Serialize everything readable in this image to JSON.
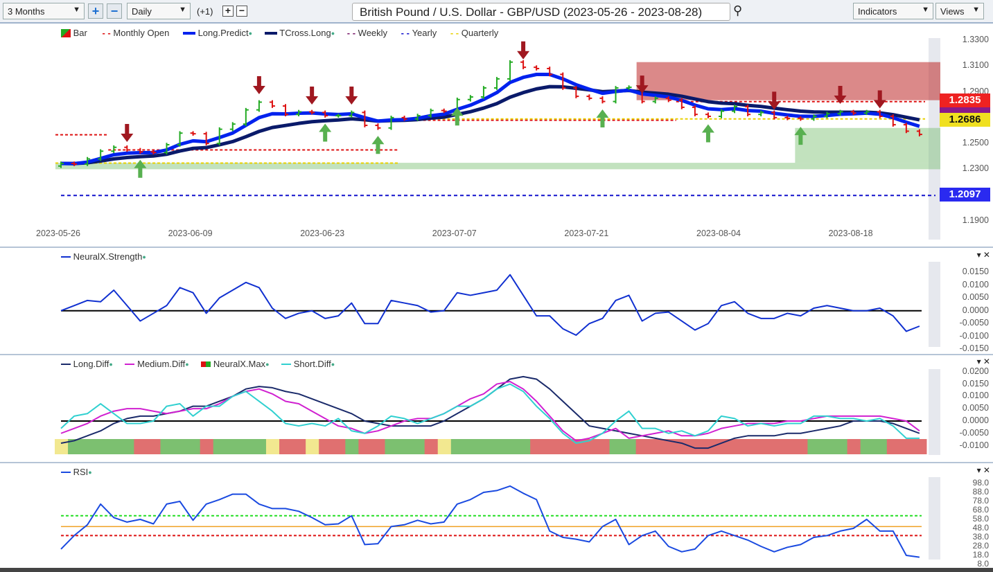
{
  "toolbar": {
    "range": "3 Months",
    "interval": "Daily",
    "offset": "(+1)",
    "title": "British Pound / U.S. Dollar - GBP/USD (2023-05-26 - 2023-08-28)",
    "indicators": "Indicators",
    "views": "Views"
  },
  "colors": {
    "bull": "#22aa22",
    "bear": "#dd1111",
    "long_predict": "#0022ee",
    "tcross": "#0a1a6a",
    "monthly": "#dd1111",
    "weekly": "#7a1a6a",
    "yearly": "#1010cc",
    "quarterly": "#e8d000",
    "strength": "#1030d0",
    "long_diff": "#1a2a6a",
    "medium_diff": "#d020d0",
    "short_diff": "#30d0d0",
    "rsi": "#1a4ae0"
  },
  "price_panel": {
    "legend": [
      "Bar",
      "Monthly Open",
      "Long.Predict",
      "TCross.Long",
      "Weekly",
      "Yearly",
      "Quarterly"
    ],
    "y_ticks": [
      "1.3300",
      "1.3100",
      "1.2900",
      "1.2500",
      "1.2300",
      "1.1900"
    ],
    "x_ticks": [
      "2023-05-26",
      "2023-06-09",
      "2023-06-23",
      "2023-07-07",
      "2023-07-21",
      "2023-08-04",
      "2023-08-18"
    ],
    "price_labels": [
      {
        "value": "1.2835",
        "color": "#ee2222"
      },
      {
        "value": "1.2686",
        "color": "#f0e020"
      },
      {
        "value": "1.2097",
        "color": "#2a2af0"
      }
    ]
  },
  "chart_data": [
    {
      "type": "candlestick",
      "ylim": [
        1.19,
        1.33
      ],
      "dates_start": "2023-05-26",
      "dates_end": "2023-08-25",
      "close": [
        1.2345,
        1.234,
        1.238,
        1.244,
        1.247,
        1.245,
        1.2435,
        1.243,
        1.249,
        1.258,
        1.2575,
        1.25,
        1.261,
        1.265,
        1.276,
        1.282,
        1.279,
        1.2725,
        1.2745,
        1.274,
        1.2715,
        1.2715,
        1.274,
        1.264,
        1.262,
        1.27,
        1.269,
        1.2715,
        1.2755,
        1.275,
        1.284,
        1.286,
        1.293,
        1.3,
        1.313,
        1.309,
        1.308,
        1.3035,
        1.293,
        1.2865,
        1.285,
        1.2825,
        1.293,
        1.2935,
        1.2825,
        1.285,
        1.2835,
        1.278,
        1.2725,
        1.271,
        1.275,
        1.2785,
        1.2725,
        1.274,
        1.27,
        1.2695,
        1.269,
        1.271,
        1.273,
        1.2745,
        1.2735,
        1.2745,
        1.271,
        1.2645,
        1.2595,
        1.257
      ],
      "sell_signals": [
        "2023-06-02",
        "2023-06-16",
        "2023-06-22",
        "2023-06-27",
        "2023-07-14",
        "2023-07-27",
        "2023-08-10",
        "2023-08-17",
        "2023-08-22"
      ],
      "buy_signals": [
        "2023-06-05",
        "2023-06-23",
        "2023-06-29",
        "2023-07-07",
        "2023-07-24",
        "2023-08-03",
        "2023-08-14"
      ],
      "monthly_open": [
        {
          "from": "2023-05-26",
          "value": 1.2567
        },
        {
          "from": "2023-06-01",
          "value": 1.245
        },
        {
          "from": "2023-07-03",
          "value": 1.268
        },
        {
          "from": "2023-08-01",
          "value": 1.2824
        }
      ],
      "quarterly": [
        {
          "from": "2023-05-26",
          "value": 1.2348
        },
        {
          "from": "2023-07-03",
          "value": 1.269
        }
      ],
      "yearly": 1.2097,
      "zones": [
        {
          "type": "resistance",
          "low": 1.2835,
          "high": 1.313,
          "from": "2023-07-27"
        },
        {
          "type": "support",
          "low": 1.23,
          "high": 1.235,
          "from": "2023-05-26"
        },
        {
          "type": "support",
          "low": 1.235,
          "high": 1.262,
          "from": "2023-08-14"
        }
      ]
    },
    {
      "type": "line",
      "name": "NeuralX.Strength",
      "ylim": [
        -0.0165,
        0.0185
      ],
      "y_ticks": [
        "0.0150",
        "0.0100",
        "0.0050",
        "0.0000",
        "-0.0050",
        "-0.0100",
        "-0.0150"
      ],
      "values": [
        0,
        0.002,
        0.004,
        0.0035,
        0.008,
        0.002,
        -0.004,
        -0.001,
        0.002,
        0.009,
        0.007,
        -0.001,
        0.005,
        0.008,
        0.011,
        0.009,
        0.001,
        -0.003,
        -0.001,
        0,
        -0.003,
        -0.002,
        0.003,
        -0.005,
        -0.005,
        0.004,
        0.003,
        0.002,
        -0.0005,
        0,
        0.007,
        0.006,
        0.007,
        0.008,
        0.014,
        0.006,
        -0.002,
        -0.002,
        -0.007,
        -0.0095,
        -0.005,
        -0.003,
        0.004,
        0.006,
        -0.004,
        -0.001,
        -0.0005,
        -0.004,
        -0.0075,
        -0.005,
        0.002,
        0.0035,
        -0.001,
        -0.003,
        -0.003,
        -0.001,
        -0.002,
        0.001,
        0.002,
        0.001,
        0,
        0,
        0.001,
        -0.002,
        -0.008,
        -0.006
      ]
    },
    {
      "type": "line",
      "ylim": [
        -0.0135,
        0.0205
      ],
      "y_ticks": [
        "0.0200",
        "0.0150",
        "0.0100",
        "0.0050",
        "0.0000",
        "-0.0050",
        "-0.0100"
      ],
      "series": [
        {
          "name": "Long.Diff",
          "values": [
            -0.009,
            -0.008,
            -0.006,
            -0.004,
            -0.001,
            0.001,
            0.002,
            0.002,
            0.003,
            0.004,
            0.006,
            0.006,
            0.008,
            0.01,
            0.013,
            0.014,
            0.0135,
            0.012,
            0.011,
            0.009,
            0.007,
            0.005,
            0.003,
            0,
            -0.001,
            -0.002,
            -0.002,
            -0.002,
            -0.002,
            0,
            0.003,
            0.006,
            0.009,
            0.013,
            0.017,
            0.018,
            0.017,
            0.013,
            0.008,
            0.003,
            -0.002,
            -0.003,
            -0.004,
            -0.005,
            -0.006,
            -0.007,
            -0.008,
            -0.009,
            -0.011,
            -0.011,
            -0.009,
            -0.007,
            -0.006,
            -0.006,
            -0.006,
            -0.005,
            -0.005,
            -0.004,
            -0.003,
            -0.002,
            0,
            0,
            0,
            -0.001,
            -0.003,
            -0.005
          ]
        },
        {
          "name": "Medium.Diff",
          "values": [
            -0.005,
            -0.003,
            -0.001,
            0.002,
            0.004,
            0.005,
            0.005,
            0.004,
            0.003,
            0.004,
            0.005,
            0.005,
            0.007,
            0.01,
            0.012,
            0.013,
            0.011,
            0.008,
            0.007,
            0.004,
            0.001,
            -0.002,
            -0.003,
            -0.005,
            -0.004,
            -0.002,
            0,
            0.001,
            0.001,
            0.003,
            0.006,
            0.009,
            0.011,
            0.015,
            0.016,
            0.013,
            0.008,
            0.002,
            -0.004,
            -0.008,
            -0.007,
            -0.005,
            -0.003,
            -0.007,
            -0.006,
            -0.005,
            -0.004,
            -0.006,
            -0.006,
            -0.005,
            -0.003,
            -0.002,
            -0.001,
            -0.001,
            -0.001,
            0,
            0,
            0.001,
            0.002,
            0.002,
            0.002,
            0.002,
            0.002,
            0.001,
            0,
            -0.004
          ]
        },
        {
          "name": "Short.Diff",
          "values": [
            -0.003,
            0.002,
            0.003,
            0.007,
            0.003,
            -0.001,
            -0.001,
            0,
            0.006,
            0.007,
            0.002,
            0.006,
            0.006,
            0.01,
            0.012,
            0.008,
            0.004,
            -0.001,
            -0.002,
            -0.001,
            -0.002,
            0.001,
            -0.004,
            -0.005,
            -0.002,
            0.002,
            0.001,
            -0.001,
            0.001,
            0.003,
            0.006,
            0.006,
            0.009,
            0.013,
            0.015,
            0.012,
            0.006,
            0.001,
            -0.005,
            -0.009,
            -0.008,
            -0.005,
            0,
            0.004,
            -0.003,
            -0.003,
            -0.005,
            -0.004,
            -0.006,
            -0.004,
            0.002,
            0.001,
            -0.002,
            -0.001,
            -0.002,
            -0.001,
            -0.001,
            0.002,
            0.002,
            0.001,
            0.001,
            0,
            0.001,
            -0.002,
            -0.007,
            -0.007
          ]
        }
      ],
      "neuralx_max": [
        "y",
        "g",
        "g",
        "g",
        "g",
        "g",
        "r",
        "r",
        "g",
        "g",
        "g",
        "r",
        "g",
        "g",
        "g",
        "g",
        "y",
        "r",
        "r",
        "y",
        "r",
        "r",
        "g",
        "r",
        "r",
        "g",
        "g",
        "g",
        "r",
        "y",
        "g",
        "g",
        "g",
        "g",
        "g",
        "g",
        "r",
        "r",
        "r",
        "r",
        "r",
        "r",
        "g",
        "g",
        "r",
        "r",
        "r",
        "r",
        "r",
        "r",
        "r",
        "r",
        "r",
        "r",
        "r",
        "r",
        "r",
        "g",
        "g",
        "g",
        "r",
        "g",
        "g",
        "r",
        "r",
        "r"
      ]
    },
    {
      "type": "line",
      "name": "RSI",
      "ylim": [
        5,
        101
      ],
      "y_ticks": [
        "98.0",
        "88.0",
        "78.0",
        "68.0",
        "58.0",
        "48.0",
        "38.0",
        "28.0",
        "18.0",
        "8.0"
      ],
      "levels": [
        {
          "value": 62,
          "color": "#22dd22"
        },
        {
          "value": 50,
          "color": "#f0a020"
        },
        {
          "value": 40,
          "color": "#dd1111"
        }
      ],
      "values": [
        25,
        40,
        52,
        75,
        60,
        55,
        58,
        53,
        75,
        78,
        57,
        75,
        80,
        86,
        86,
        75,
        70,
        70,
        67,
        60,
        52,
        53,
        62,
        30,
        31,
        50,
        52,
        57,
        53,
        55,
        75,
        80,
        88,
        90,
        95,
        87,
        80,
        45,
        38,
        36,
        33,
        50,
        58,
        30,
        40,
        45,
        28,
        22,
        25,
        40,
        45,
        40,
        35,
        28,
        22,
        27,
        30,
        38,
        40,
        45,
        48,
        58,
        45,
        45,
        18,
        16
      ]
    }
  ],
  "panels": {
    "strength_legend": "NeuralX.Strength",
    "diff_legend": [
      "Long.Diff",
      "Medium.Diff",
      "NeuralX.Max",
      "Short.Diff"
    ],
    "rsi_legend": "RSI"
  }
}
